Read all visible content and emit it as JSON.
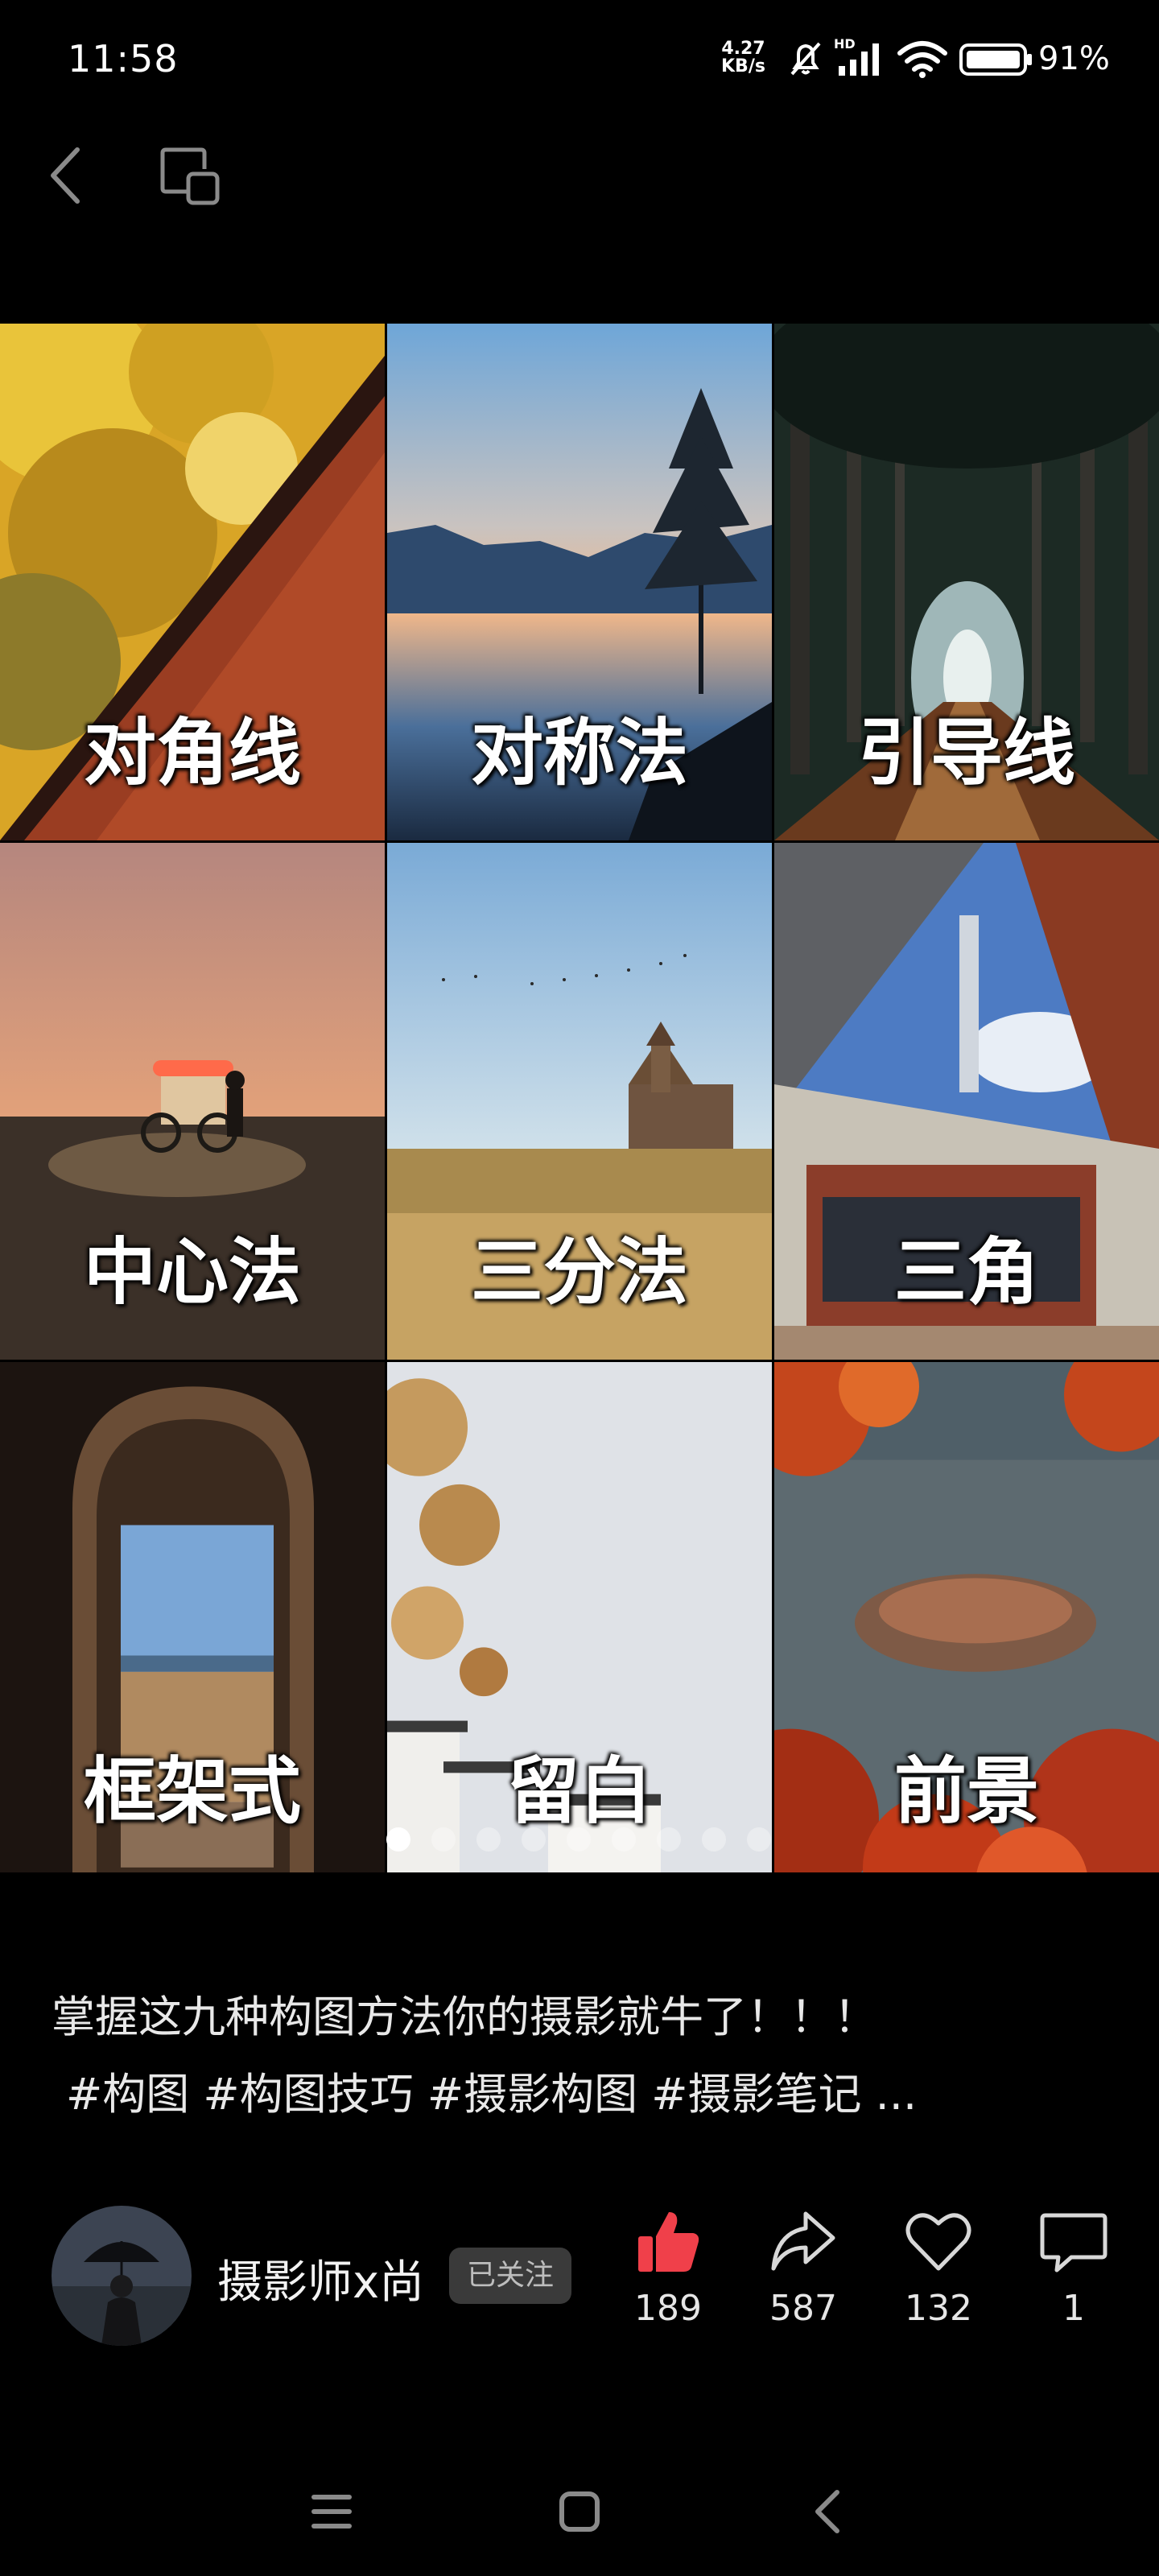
{
  "status_bar": {
    "time": "11:58",
    "net_speed_value": "4.27",
    "net_speed_unit": "KB/s",
    "hd_label": "HD",
    "battery": "91%"
  },
  "gallery": {
    "tiles": [
      {
        "label": "对角线"
      },
      {
        "label": "对称法"
      },
      {
        "label": "引导线"
      },
      {
        "label": "中心法"
      },
      {
        "label": "三分法"
      },
      {
        "label": "三角"
      },
      {
        "label": "框架式"
      },
      {
        "label": "留白"
      },
      {
        "label": "前景"
      }
    ],
    "page_count": 9,
    "active_page": 1
  },
  "caption": {
    "text": "掌握这九种构图方法你的摄影就牛了！！！",
    "tags": "#构图 #构图技巧 #摄影构图 #摄影笔记 ..."
  },
  "author": {
    "name": "摄影师x尚",
    "follow_status": "已关注"
  },
  "actions": {
    "like": "189",
    "share": "587",
    "favorite": "132",
    "comment": "1"
  },
  "colors": {
    "like_active": "#f0404a",
    "background": "#000000"
  }
}
